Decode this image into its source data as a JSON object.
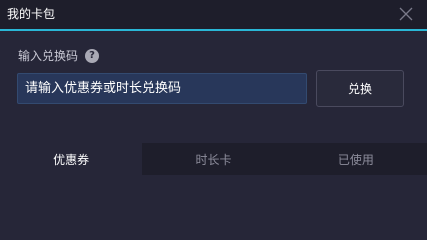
{
  "window": {
    "title": "我的卡包",
    "accent_color": "#2ab7d6",
    "close_icon": "close-icon"
  },
  "redeem": {
    "label": "输入兑换码",
    "help_icon": "question-circle-icon",
    "help_glyph": "?",
    "input_placeholder": "请输入优惠券或时长兑换码",
    "input_value": "",
    "button_label": "兑换"
  },
  "tabs": [
    {
      "label": "优惠券",
      "active": true
    },
    {
      "label": "时长卡",
      "active": false
    },
    {
      "label": "已使用",
      "active": false
    }
  ]
}
